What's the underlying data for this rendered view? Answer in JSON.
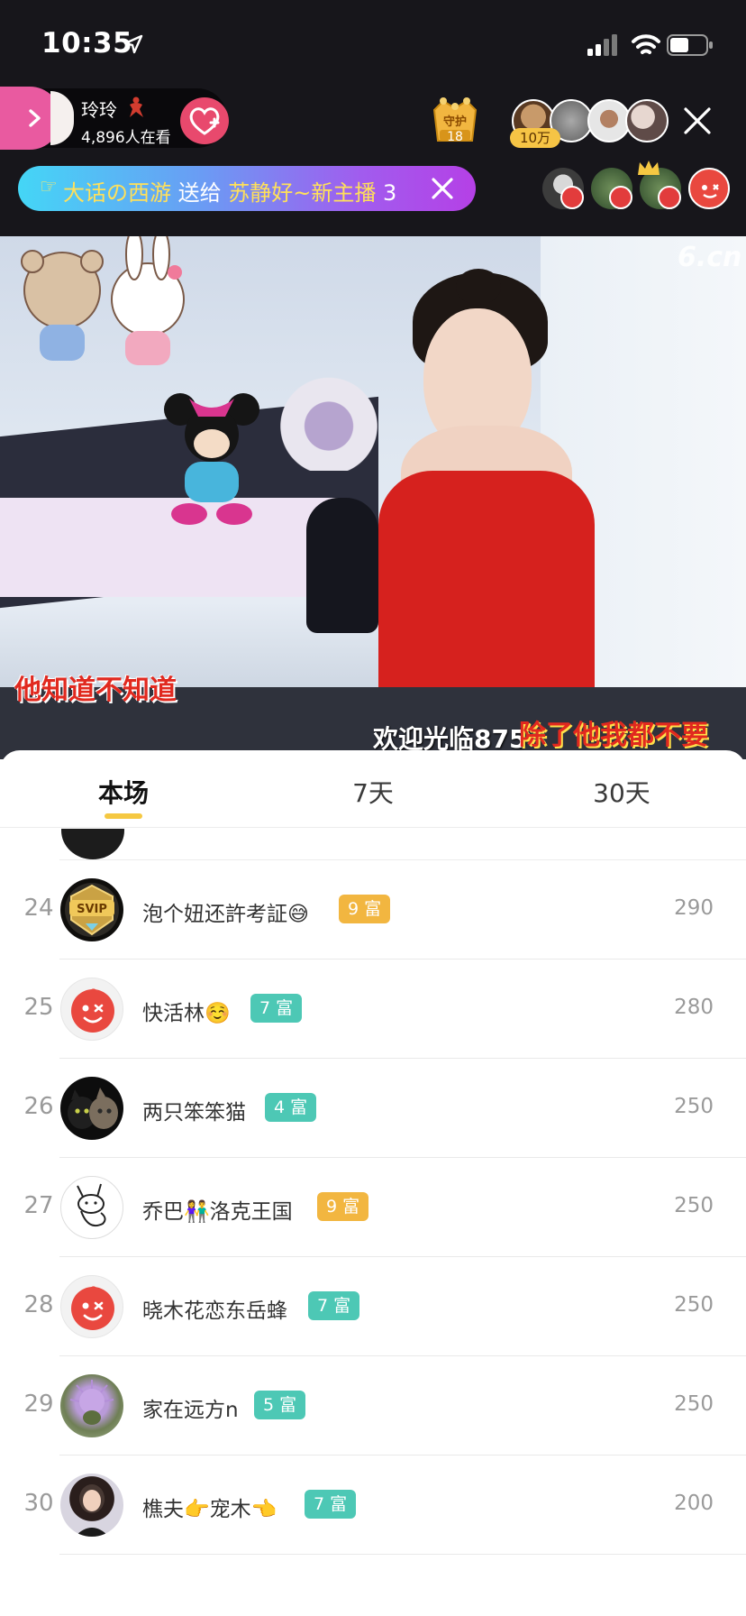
{
  "status_bar": {
    "time": "10:35"
  },
  "anchor": {
    "name": "玲玲",
    "viewers": "4,896人在看"
  },
  "guard": {
    "label": "守护",
    "count": "18"
  },
  "top_viewers_badge": "10万",
  "gift_banner": {
    "hand": "☞",
    "prefix": "大话の西游",
    "middle": " 送给 ",
    "target": "苏静好~新主播",
    "suffix": " 3"
  },
  "video": {
    "watermark": "6.cn",
    "caption_left": "他知道不知道",
    "caption_scroll": "欢迎光临875",
    "caption_right": "除了他我都不要"
  },
  "tabs": [
    {
      "label": "本场"
    },
    {
      "label": "7天"
    },
    {
      "label": "30天"
    }
  ],
  "ranking": [
    {
      "rank": "24",
      "name": "泡个妞还許考証😅",
      "level": "9 富",
      "level_color": "#f2b640",
      "score": "290",
      "avatar": "svip-avatar"
    },
    {
      "rank": "25",
      "name": "快活林☺️",
      "level": "7 富",
      "level_color": "#4dc8b5",
      "score": "280",
      "avatar": "default-red-avatar"
    },
    {
      "rank": "26",
      "name": "两只笨笨猫",
      "level": "4 富",
      "level_color": "#4dc8b5",
      "score": "250",
      "avatar": "cats-avatar"
    },
    {
      "rank": "27",
      "name": "乔巴👫洛克王国",
      "level": "9 富",
      "level_color": "#f2b640",
      "score": "250",
      "avatar": "rabbit-sketch-avatar"
    },
    {
      "rank": "28",
      "name": "晓木花恋东岳蜂",
      "level": "7 富",
      "level_color": "#4dc8b5",
      "score": "250",
      "avatar": "default-red-avatar"
    },
    {
      "rank": "29",
      "name": "家在远方n",
      "level": "5 富",
      "level_color": "#4dc8b5",
      "score": "250",
      "avatar": "thistle-avatar"
    },
    {
      "rank": "30",
      "name": "樵夫👉宠木👈",
      "level": "7 富",
      "level_color": "#4dc8b5",
      "score": "200",
      "avatar": "woman-avatar"
    }
  ],
  "colors": {
    "header_bg": "#17161b",
    "accent_pink": "#e95aa0",
    "follow_red": "#e8496d",
    "tab_underline": "#f5c842",
    "level_gold": "#f2b640",
    "level_teal": "#4dc8b5"
  }
}
